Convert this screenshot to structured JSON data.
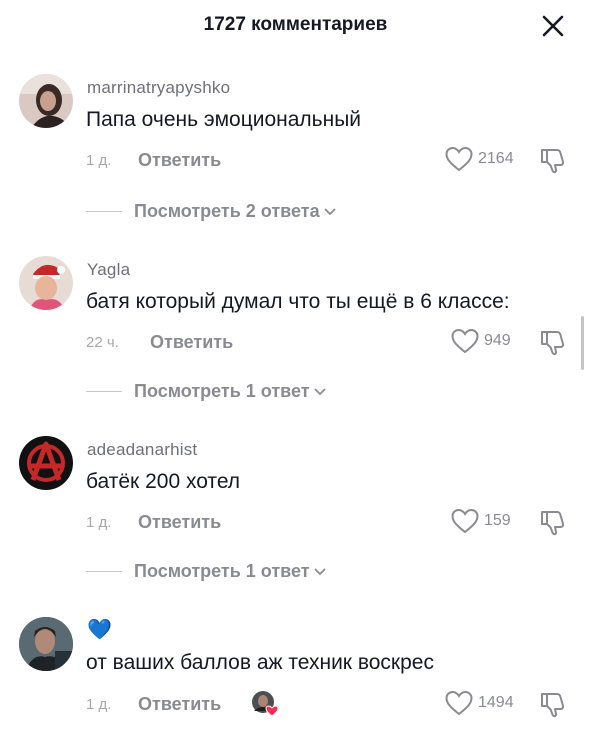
{
  "header": {
    "title": "1727 комментариев"
  },
  "comments": [
    {
      "username": "marrinatryapyshko",
      "text": "Папа очень эмоциональный",
      "time": "1 д.",
      "reply_label": "Ответить",
      "likes": "2164",
      "view_replies": "Посмотреть 2 ответа"
    },
    {
      "username": "Yagla",
      "text": "батя который думал что ты ещё в 6 классе:",
      "time": "22 ч.",
      "reply_label": "Ответить",
      "likes": "949",
      "view_replies": "Посмотреть 1 ответ"
    },
    {
      "username": "adeadanarhist",
      "text": "батёк 200 хотел",
      "time": "1 д.",
      "reply_label": "Ответить",
      "likes": "159",
      "view_replies": "Посмотреть 1 ответ"
    },
    {
      "username": "💙",
      "text": "от ваших баллов аж техник воскрес",
      "time": "1 д.",
      "reply_label": "Ответить",
      "likes": "1494"
    }
  ],
  "colors": {
    "text_primary": "#161823",
    "text_secondary": "#8a8b91",
    "username": "#6f7078",
    "accent_heart": "#fe2c55"
  },
  "icons": {
    "close": "close-icon",
    "like": "heart-outline-icon",
    "dislike": "thumbs-down-icon",
    "chevron": "chevron-down-icon"
  }
}
